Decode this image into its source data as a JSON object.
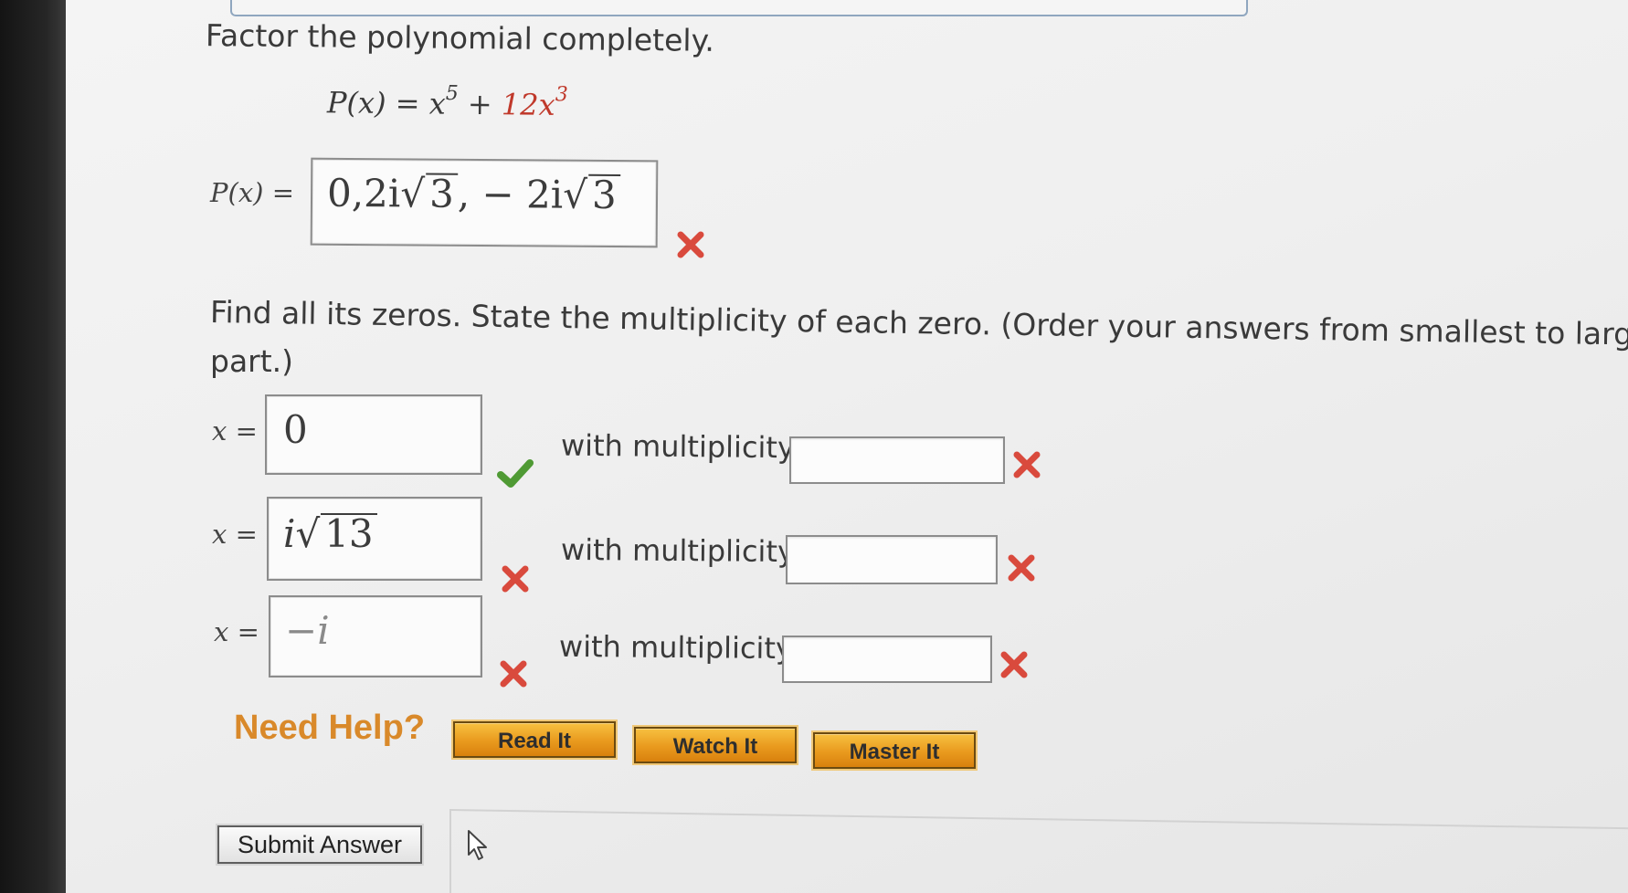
{
  "problem": {
    "instruction": "Factor the polynomial completely.",
    "polynomial": {
      "lhs": "P(x) = ",
      "term1_base": "x",
      "term1_exp": "5",
      "plus": " + ",
      "term2_coef_base": "12x",
      "term2_exp": "3"
    },
    "factor_label": "P(x) =",
    "factor_answer": {
      "prefix": "0,2i",
      "radicand1": "3",
      "middle": ", − 2i",
      "radicand2": "3",
      "status": "incorrect"
    },
    "zeros_instruction_line1": "Find all its zeros. State the multiplicity of each zero. (Order your answers from smallest to largest rea",
    "zeros_instruction_line2": "part.)",
    "zeros": [
      {
        "label": "x =",
        "value": "0",
        "value_status": "correct",
        "mult_label": "with multiplicity",
        "mult_value": "",
        "mult_status": "incorrect"
      },
      {
        "label": "x =",
        "value_prefix": "i",
        "value_radicand": "13",
        "value_status": "incorrect",
        "mult_label": "with multiplicity",
        "mult_value": "",
        "mult_status": "incorrect"
      },
      {
        "label": "x =",
        "value": "−i",
        "value_status": "incorrect",
        "mult_label": "with multiplicity",
        "mult_value": "",
        "mult_status": "incorrect"
      }
    ]
  },
  "help": {
    "label": "Need Help?",
    "buttons": [
      "Read It",
      "Watch It",
      "Master It"
    ]
  },
  "submit_label": "Submit Answer",
  "colors": {
    "incorrect": "#d94a3d",
    "correct": "#4f9a34",
    "help_accent": "#d9892a",
    "highlight_red": "#c0392b"
  },
  "icons": {
    "incorrect": "x-mark-icon",
    "correct": "checkmark-icon",
    "cursor": "mouse-pointer-icon"
  }
}
